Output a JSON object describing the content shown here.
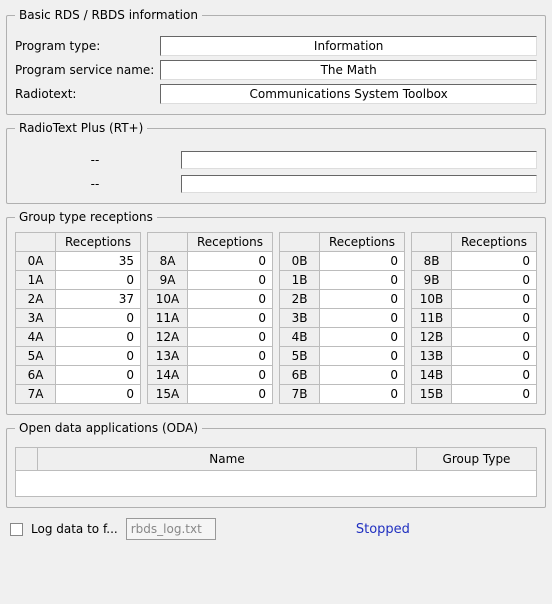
{
  "basic": {
    "legend": "Basic RDS / RBDS information",
    "program_type_label": "Program type:",
    "program_type_value": "Information",
    "service_name_label": "Program service name:",
    "service_name_value": "The Math",
    "radiotext_label": "Radiotext:",
    "radiotext_value": "Communications System Toolbox"
  },
  "rtplus": {
    "legend": "RadioText Plus (RT+)",
    "rows": [
      {
        "key": "--",
        "value": ""
      },
      {
        "key": "--",
        "value": ""
      }
    ]
  },
  "groups": {
    "legend": "Group type receptions",
    "header": "Receptions",
    "cols": [
      [
        {
          "id": "0A",
          "count": 35
        },
        {
          "id": "1A",
          "count": 0
        },
        {
          "id": "2A",
          "count": 37
        },
        {
          "id": "3A",
          "count": 0
        },
        {
          "id": "4A",
          "count": 0
        },
        {
          "id": "5A",
          "count": 0
        },
        {
          "id": "6A",
          "count": 0
        },
        {
          "id": "7A",
          "count": 0
        }
      ],
      [
        {
          "id": "8A",
          "count": 0
        },
        {
          "id": "9A",
          "count": 0
        },
        {
          "id": "10A",
          "count": 0
        },
        {
          "id": "11A",
          "count": 0
        },
        {
          "id": "12A",
          "count": 0
        },
        {
          "id": "13A",
          "count": 0
        },
        {
          "id": "14A",
          "count": 0
        },
        {
          "id": "15A",
          "count": 0
        }
      ],
      [
        {
          "id": "0B",
          "count": 0
        },
        {
          "id": "1B",
          "count": 0
        },
        {
          "id": "2B",
          "count": 0
        },
        {
          "id": "3B",
          "count": 0
        },
        {
          "id": "4B",
          "count": 0
        },
        {
          "id": "5B",
          "count": 0
        },
        {
          "id": "6B",
          "count": 0
        },
        {
          "id": "7B",
          "count": 0
        }
      ],
      [
        {
          "id": "8B",
          "count": 0
        },
        {
          "id": "9B",
          "count": 0
        },
        {
          "id": "10B",
          "count": 0
        },
        {
          "id": "11B",
          "count": 0
        },
        {
          "id": "12B",
          "count": 0
        },
        {
          "id": "13B",
          "count": 0
        },
        {
          "id": "14B",
          "count": 0
        },
        {
          "id": "15B",
          "count": 0
        }
      ]
    ]
  },
  "oda": {
    "legend": "Open data applications (ODA)",
    "name_header": "Name",
    "group_type_header": "Group Type"
  },
  "bottom": {
    "log_label": "Log data to f...",
    "log_filename": "rbds_log.txt",
    "status": "Stopped"
  }
}
